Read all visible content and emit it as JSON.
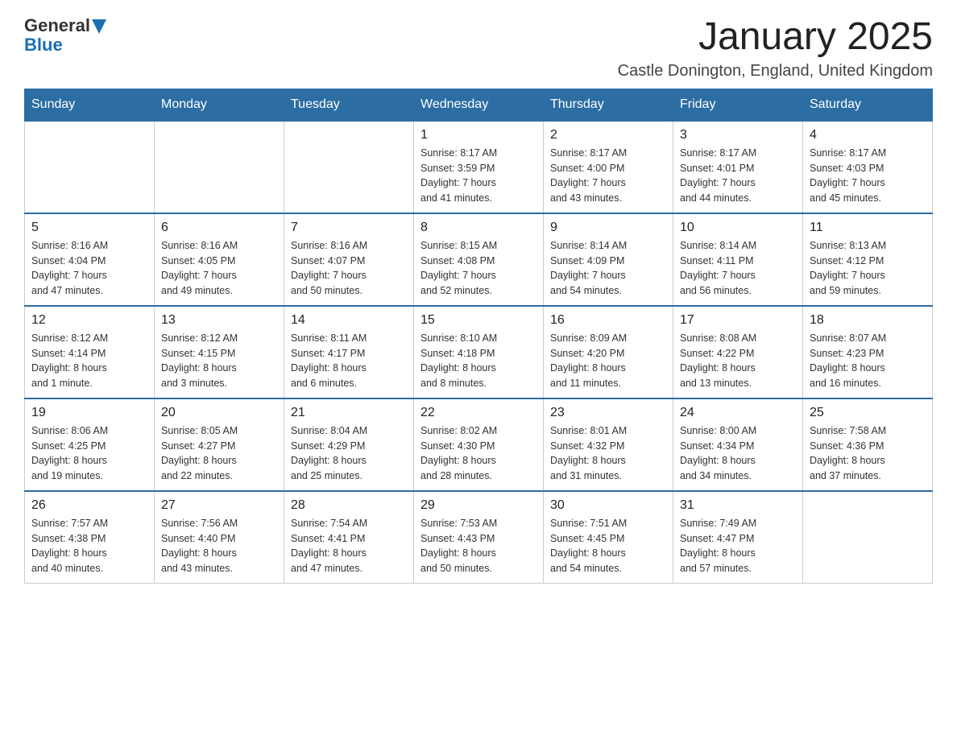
{
  "header": {
    "logo": {
      "text_general": "General",
      "text_blue": "Blue",
      "alt": "GeneralBlue logo"
    },
    "title": "January 2025",
    "location": "Castle Donington, England, United Kingdom"
  },
  "calendar": {
    "days_of_week": [
      "Sunday",
      "Monday",
      "Tuesday",
      "Wednesday",
      "Thursday",
      "Friday",
      "Saturday"
    ],
    "weeks": [
      [
        {
          "day": "",
          "info": ""
        },
        {
          "day": "",
          "info": ""
        },
        {
          "day": "",
          "info": ""
        },
        {
          "day": "1",
          "info": "Sunrise: 8:17 AM\nSunset: 3:59 PM\nDaylight: 7 hours\nand 41 minutes."
        },
        {
          "day": "2",
          "info": "Sunrise: 8:17 AM\nSunset: 4:00 PM\nDaylight: 7 hours\nand 43 minutes."
        },
        {
          "day": "3",
          "info": "Sunrise: 8:17 AM\nSunset: 4:01 PM\nDaylight: 7 hours\nand 44 minutes."
        },
        {
          "day": "4",
          "info": "Sunrise: 8:17 AM\nSunset: 4:03 PM\nDaylight: 7 hours\nand 45 minutes."
        }
      ],
      [
        {
          "day": "5",
          "info": "Sunrise: 8:16 AM\nSunset: 4:04 PM\nDaylight: 7 hours\nand 47 minutes."
        },
        {
          "day": "6",
          "info": "Sunrise: 8:16 AM\nSunset: 4:05 PM\nDaylight: 7 hours\nand 49 minutes."
        },
        {
          "day": "7",
          "info": "Sunrise: 8:16 AM\nSunset: 4:07 PM\nDaylight: 7 hours\nand 50 minutes."
        },
        {
          "day": "8",
          "info": "Sunrise: 8:15 AM\nSunset: 4:08 PM\nDaylight: 7 hours\nand 52 minutes."
        },
        {
          "day": "9",
          "info": "Sunrise: 8:14 AM\nSunset: 4:09 PM\nDaylight: 7 hours\nand 54 minutes."
        },
        {
          "day": "10",
          "info": "Sunrise: 8:14 AM\nSunset: 4:11 PM\nDaylight: 7 hours\nand 56 minutes."
        },
        {
          "day": "11",
          "info": "Sunrise: 8:13 AM\nSunset: 4:12 PM\nDaylight: 7 hours\nand 59 minutes."
        }
      ],
      [
        {
          "day": "12",
          "info": "Sunrise: 8:12 AM\nSunset: 4:14 PM\nDaylight: 8 hours\nand 1 minute."
        },
        {
          "day": "13",
          "info": "Sunrise: 8:12 AM\nSunset: 4:15 PM\nDaylight: 8 hours\nand 3 minutes."
        },
        {
          "day": "14",
          "info": "Sunrise: 8:11 AM\nSunset: 4:17 PM\nDaylight: 8 hours\nand 6 minutes."
        },
        {
          "day": "15",
          "info": "Sunrise: 8:10 AM\nSunset: 4:18 PM\nDaylight: 8 hours\nand 8 minutes."
        },
        {
          "day": "16",
          "info": "Sunrise: 8:09 AM\nSunset: 4:20 PM\nDaylight: 8 hours\nand 11 minutes."
        },
        {
          "day": "17",
          "info": "Sunrise: 8:08 AM\nSunset: 4:22 PM\nDaylight: 8 hours\nand 13 minutes."
        },
        {
          "day": "18",
          "info": "Sunrise: 8:07 AM\nSunset: 4:23 PM\nDaylight: 8 hours\nand 16 minutes."
        }
      ],
      [
        {
          "day": "19",
          "info": "Sunrise: 8:06 AM\nSunset: 4:25 PM\nDaylight: 8 hours\nand 19 minutes."
        },
        {
          "day": "20",
          "info": "Sunrise: 8:05 AM\nSunset: 4:27 PM\nDaylight: 8 hours\nand 22 minutes."
        },
        {
          "day": "21",
          "info": "Sunrise: 8:04 AM\nSunset: 4:29 PM\nDaylight: 8 hours\nand 25 minutes."
        },
        {
          "day": "22",
          "info": "Sunrise: 8:02 AM\nSunset: 4:30 PM\nDaylight: 8 hours\nand 28 minutes."
        },
        {
          "day": "23",
          "info": "Sunrise: 8:01 AM\nSunset: 4:32 PM\nDaylight: 8 hours\nand 31 minutes."
        },
        {
          "day": "24",
          "info": "Sunrise: 8:00 AM\nSunset: 4:34 PM\nDaylight: 8 hours\nand 34 minutes."
        },
        {
          "day": "25",
          "info": "Sunrise: 7:58 AM\nSunset: 4:36 PM\nDaylight: 8 hours\nand 37 minutes."
        }
      ],
      [
        {
          "day": "26",
          "info": "Sunrise: 7:57 AM\nSunset: 4:38 PM\nDaylight: 8 hours\nand 40 minutes."
        },
        {
          "day": "27",
          "info": "Sunrise: 7:56 AM\nSunset: 4:40 PM\nDaylight: 8 hours\nand 43 minutes."
        },
        {
          "day": "28",
          "info": "Sunrise: 7:54 AM\nSunset: 4:41 PM\nDaylight: 8 hours\nand 47 minutes."
        },
        {
          "day": "29",
          "info": "Sunrise: 7:53 AM\nSunset: 4:43 PM\nDaylight: 8 hours\nand 50 minutes."
        },
        {
          "day": "30",
          "info": "Sunrise: 7:51 AM\nSunset: 4:45 PM\nDaylight: 8 hours\nand 54 minutes."
        },
        {
          "day": "31",
          "info": "Sunrise: 7:49 AM\nSunset: 4:47 PM\nDaylight: 8 hours\nand 57 minutes."
        },
        {
          "day": "",
          "info": ""
        }
      ]
    ]
  }
}
